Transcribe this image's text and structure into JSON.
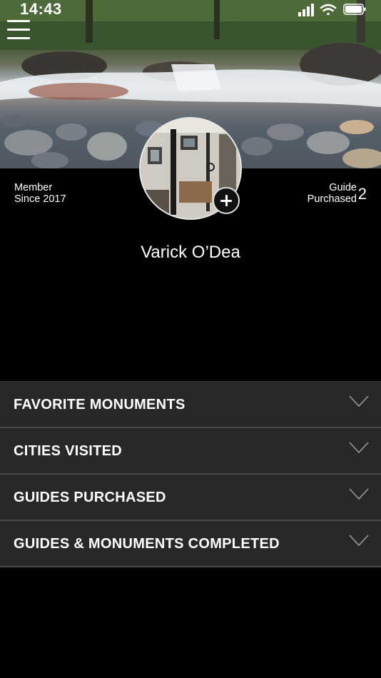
{
  "status_bar": {
    "time": "14:43",
    "icons": [
      "location-arrow-icon",
      "cellular-signal-icon",
      "wifi-icon",
      "battery-icon"
    ]
  },
  "profile": {
    "member_label_line1": "Member",
    "member_label_line2": "Since 2017",
    "guide_label_line1": "Guide",
    "guide_label_line2": "Purchased",
    "guide_count": "2",
    "name": "Varick O’Dea"
  },
  "sections": [
    {
      "label": "FAVORITE MONUMENTS",
      "icon": "chevron-down-icon"
    },
    {
      "label": "CITIES VISITED",
      "icon": "chevron-down-icon"
    },
    {
      "label": "GUIDES PURCHASED",
      "icon": "chevron-down-icon"
    },
    {
      "label": "GUIDES & MONUMENTS COMPLETED",
      "icon": "chevron-down-icon"
    }
  ],
  "colors": {
    "background": "#000000",
    "row_background": "#282828",
    "row_divider": "#4a4a4a",
    "text": "#ffffff"
  }
}
